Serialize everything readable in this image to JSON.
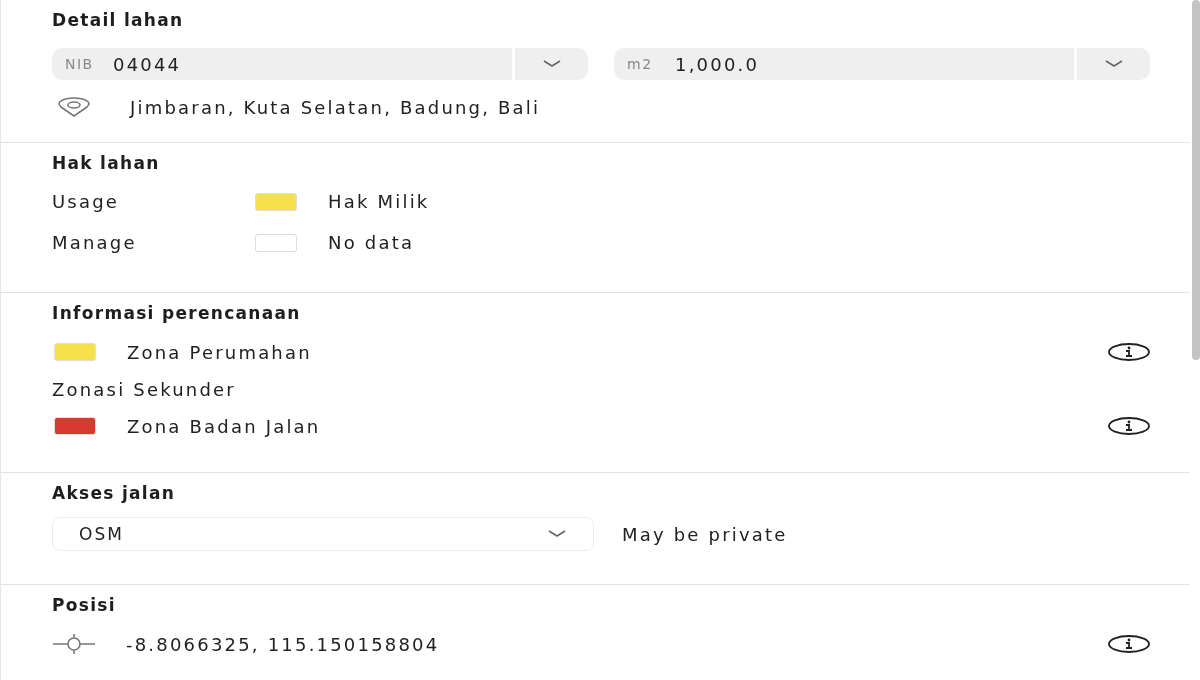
{
  "detail": {
    "title": "Detail lahan",
    "fields": [
      {
        "prefix": "NIB",
        "value": "04044"
      },
      {
        "prefix": "m2",
        "value": "1,000.0"
      }
    ],
    "address": "Jimbaran, Kuta Selatan, Badung, Bali"
  },
  "rights": {
    "title": "Hak lahan",
    "rows": [
      {
        "label": "Usage",
        "color": "#f5e14a",
        "value": "Hak Milik"
      },
      {
        "label": "Manage",
        "color": "#ffffff",
        "value": "No data"
      }
    ]
  },
  "planning": {
    "title": "Informasi perencanaan",
    "items": [
      {
        "kind": "zone",
        "color": "#f5e14a",
        "label": "Zona Perumahan"
      },
      {
        "kind": "subheading",
        "label": "Zonasi Sekunder"
      },
      {
        "kind": "zone",
        "color": "#d93a30",
        "label": "Zona Badan Jalan"
      }
    ]
  },
  "road": {
    "title": "Akses jalan",
    "source": "OSM",
    "note": "May be private"
  },
  "position": {
    "title": "Posisi",
    "coords": "-8.8066325, 115.150158804"
  }
}
